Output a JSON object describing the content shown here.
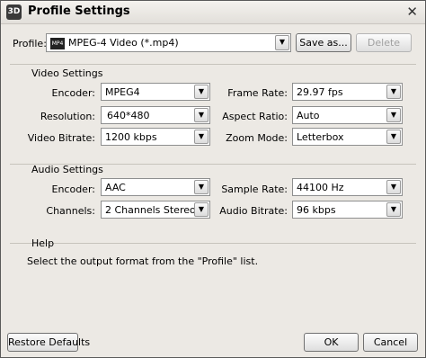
{
  "window": {
    "title": "Profile Settings"
  },
  "profile": {
    "label": "Profile:",
    "value": "MPEG-4 Video (*.mp4)",
    "save_as": "Save as...",
    "delete": "Delete"
  },
  "video": {
    "heading": "Video Settings",
    "encoder_label": "Encoder:",
    "encoder": "MPEG4",
    "resolution_label": "Resolution:",
    "resolution": "640*480",
    "bitrate_label": "Video Bitrate:",
    "bitrate": "1200 kbps",
    "framerate_label": "Frame Rate:",
    "framerate": "29.97 fps",
    "aspect_label": "Aspect Ratio:",
    "aspect": "Auto",
    "zoom_label": "Zoom Mode:",
    "zoom": "Letterbox"
  },
  "audio": {
    "heading": "Audio Settings",
    "encoder_label": "Encoder:",
    "encoder": "AAC",
    "channels_label": "Channels:",
    "channels": "2 Channels Stereo",
    "samplerate_label": "Sample Rate:",
    "samplerate": "44100 Hz",
    "bitrate_label": "Audio Bitrate:",
    "bitrate": "96 kbps"
  },
  "help": {
    "heading": "Help",
    "text": "Select the output format from the \"Profile\" list."
  },
  "footer": {
    "restore": "Restore Defaults",
    "ok": "OK",
    "cancel": "Cancel"
  },
  "glyphs": {
    "dropdown": "▼",
    "close": "✕",
    "app_icon": "3D",
    "mp4_badge": "MP4"
  }
}
